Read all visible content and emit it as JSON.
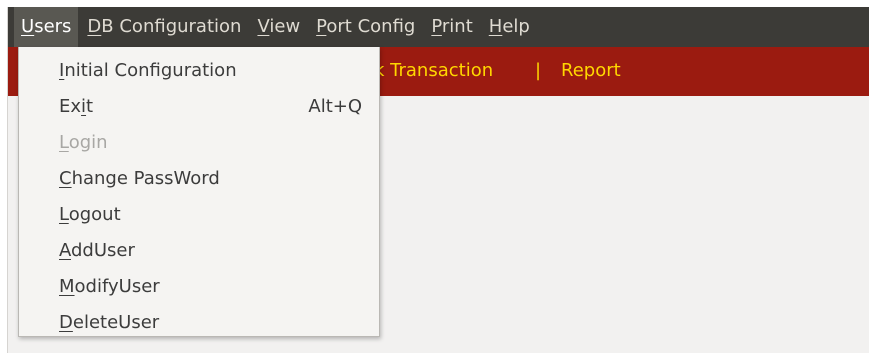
{
  "menubar": {
    "items": [
      {
        "pre": "",
        "mn": "U",
        "post": "sers"
      },
      {
        "pre": "",
        "mn": "D",
        "post": "B Configuration"
      },
      {
        "pre": "",
        "mn": "V",
        "post": "iew"
      },
      {
        "pre": "",
        "mn": "P",
        "post": "ort Config"
      },
      {
        "pre": "",
        "mn": "P",
        "post": "rint"
      },
      {
        "pre": "",
        "mn": "H",
        "post": "elp"
      }
    ]
  },
  "toolbar": {
    "transaction_label": "k Transaction",
    "separator": "|",
    "report_label": "Report"
  },
  "users_menu": {
    "items": [
      {
        "pre": "",
        "mn": "I",
        "post": "nitial Configuration",
        "shortcut": ""
      },
      {
        "pre": "Ex",
        "mn": "i",
        "post": "t",
        "shortcut": "Alt+Q"
      },
      {
        "pre": "",
        "mn": "L",
        "post": "ogin",
        "shortcut": ""
      },
      {
        "pre": "",
        "mn": "C",
        "post": "hange PassWord",
        "shortcut": ""
      },
      {
        "pre": "",
        "mn": "L",
        "post": "ogout",
        "shortcut": ""
      },
      {
        "pre": "",
        "mn": "A",
        "post": "ddUser",
        "shortcut": ""
      },
      {
        "pre": "",
        "mn": "M",
        "post": "odifyUser",
        "shortcut": ""
      },
      {
        "pre": "",
        "mn": "D",
        "post": "eleteUser",
        "shortcut": ""
      }
    ]
  },
  "colors": {
    "menubar_bg": "#3c3b37",
    "toolbar_bg": "#9b1b10",
    "toolbar_text": "#ffd700",
    "menu_bg": "#f5f4f2"
  }
}
